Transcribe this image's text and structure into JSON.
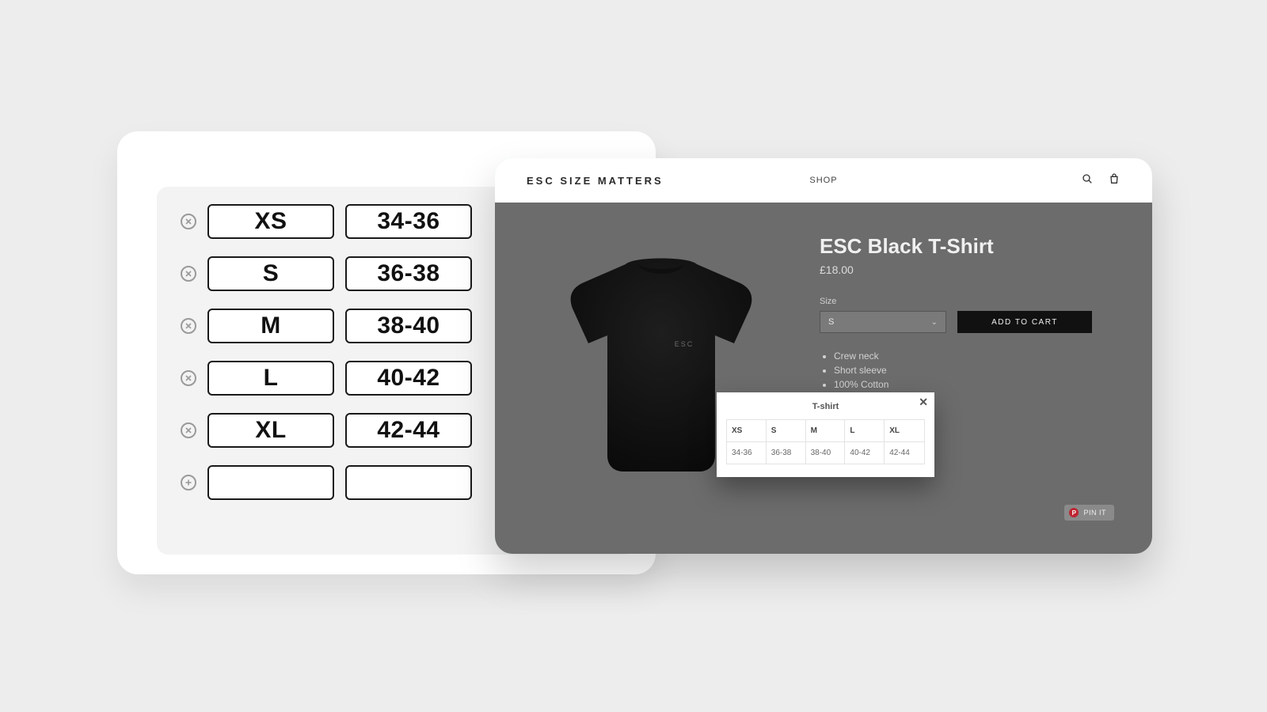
{
  "editor": {
    "rows": [
      {
        "size": "XS",
        "range": "34-36"
      },
      {
        "size": "S",
        "range": "36-38"
      },
      {
        "size": "M",
        "range": "38-40"
      },
      {
        "size": "L",
        "range": "40-42"
      },
      {
        "size": "XL",
        "range": "42-44"
      }
    ]
  },
  "store": {
    "brand": "ESC SIZE MATTERS",
    "nav": "SHOP",
    "product": {
      "title": "ESC Black T-Shirt",
      "price": "£18.00",
      "size_label": "Size",
      "selected_size": "S",
      "add_to_cart": "ADD TO CART",
      "tshirt_text": "ESC",
      "features": [
        "Crew neck",
        "Short sleeve",
        "100% Cotton"
      ]
    },
    "pin_label": "PIN IT"
  },
  "popup": {
    "title": "T-shirt",
    "headers": [
      "XS",
      "S",
      "M",
      "L",
      "XL"
    ],
    "values": [
      "34-36",
      "36-38",
      "38-40",
      "40-42",
      "42-44"
    ]
  }
}
